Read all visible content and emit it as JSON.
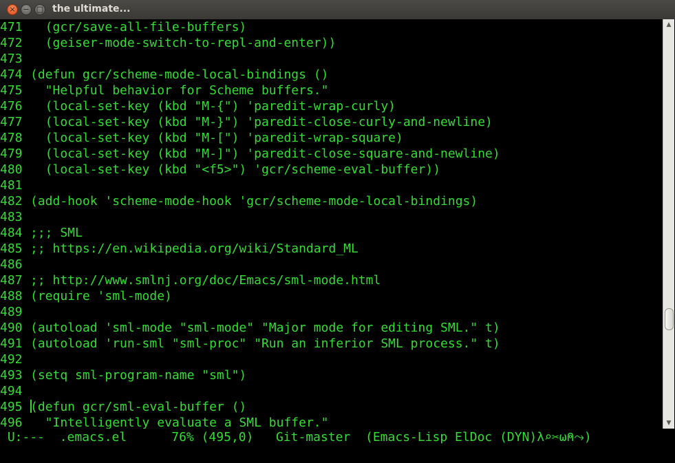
{
  "window": {
    "title": "the ultimate...",
    "close_glyph": "×",
    "minimize_glyph": "−",
    "maximize_glyph": "□"
  },
  "colors": {
    "text": "#33dd33",
    "background": "#000000"
  },
  "editor": {
    "lines": [
      {
        "num": "471",
        "text": "  (gcr/save-all-file-buffers)"
      },
      {
        "num": "472",
        "text": "  (geiser-mode-switch-to-repl-and-enter))"
      },
      {
        "num": "473",
        "text": ""
      },
      {
        "num": "474",
        "text": "(defun gcr/scheme-mode-local-bindings ()"
      },
      {
        "num": "475",
        "text": "  \"Helpful behavior for Scheme buffers.\""
      },
      {
        "num": "476",
        "text": "  (local-set-key (kbd \"M-{\") 'paredit-wrap-curly)"
      },
      {
        "num": "477",
        "text": "  (local-set-key (kbd \"M-}\") 'paredit-close-curly-and-newline)"
      },
      {
        "num": "478",
        "text": "  (local-set-key (kbd \"M-[\") 'paredit-wrap-square)"
      },
      {
        "num": "479",
        "text": "  (local-set-key (kbd \"M-]\") 'paredit-close-square-and-newline)"
      },
      {
        "num": "480",
        "text": "  (local-set-key (kbd \"<f5>\") 'gcr/scheme-eval-buffer))"
      },
      {
        "num": "481",
        "text": ""
      },
      {
        "num": "482",
        "text": "(add-hook 'scheme-mode-hook 'gcr/scheme-mode-local-bindings)"
      },
      {
        "num": "483",
        "text": ""
      },
      {
        "num": "484",
        "text": ";;; SML"
      },
      {
        "num": "485",
        "text": ";; https://en.wikipedia.org/wiki/Standard_ML"
      },
      {
        "num": "486",
        "text": ""
      },
      {
        "num": "487",
        "text": ";; http://www.smlnj.org/doc/Emacs/sml-mode.html"
      },
      {
        "num": "488",
        "text": "(require 'sml-mode)"
      },
      {
        "num": "489",
        "text": ""
      },
      {
        "num": "490",
        "text": "(autoload 'sml-mode \"sml-mode\" \"Major mode for editing SML.\" t)"
      },
      {
        "num": "491",
        "text": "(autoload 'run-sml \"sml-proc\" \"Run an inferior SML process.\" t)"
      },
      {
        "num": "492",
        "text": ""
      },
      {
        "num": "493",
        "text": "(setq sml-program-name \"sml\")"
      },
      {
        "num": "494",
        "text": ""
      },
      {
        "num": "495",
        "text": "(defun gcr/sml-eval-buffer ()",
        "cursor": true
      },
      {
        "num": "496",
        "text": "  \"Intelligently evaluate a SML buffer.\""
      }
    ]
  },
  "modeline": {
    "text": " U:---  .emacs.el      76% (495,0)   Git-master  (Emacs-Lisp ElDoc (DYN)λ⌕✂ω⍝⤳)"
  },
  "scrollbar": {
    "up_glyph": "▲",
    "down_glyph": "▼",
    "position_fraction": 0.76
  }
}
